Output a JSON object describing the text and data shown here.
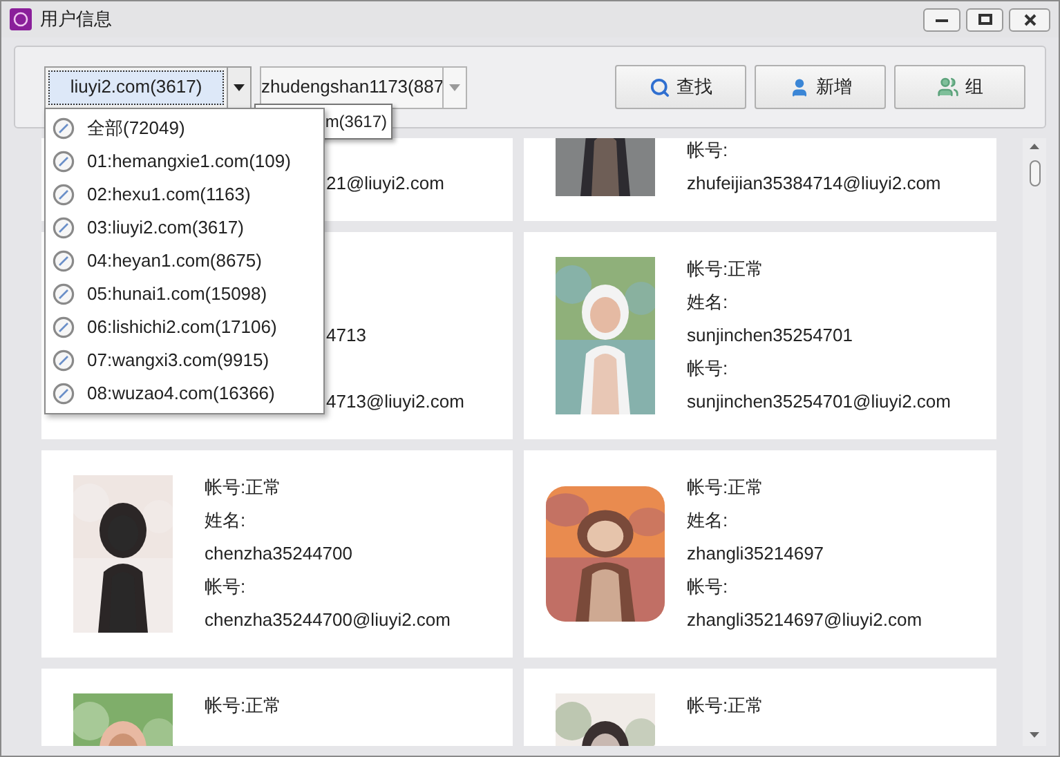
{
  "window": {
    "title": "用户信息"
  },
  "toolbar": {
    "domain_combo": {
      "value": "liuyi2.com(3617)",
      "focused": true
    },
    "user_combo": {
      "value": "zhudengshan1173(887",
      "disabled": true
    },
    "buttons": [
      {
        "kind": "search",
        "label": "查找"
      },
      {
        "kind": "add",
        "label": "新增"
      },
      {
        "kind": "group",
        "label": "组"
      }
    ]
  },
  "tooltip": {
    "text": "m(3617)"
  },
  "domain_dropdown": {
    "items": [
      {
        "label": "全部(72049)"
      },
      {
        "label": "01:hemangxie1.com(109)"
      },
      {
        "label": "02:hexu1.com(1163)"
      },
      {
        "label": "03:liuyi2.com(3617)"
      },
      {
        "label": "04:heyan1.com(8675)"
      },
      {
        "label": "05:hunai1.com(15098)"
      },
      {
        "label": "06:lishichi2.com(17106)"
      },
      {
        "label": "07:wangxi3.com(9915)"
      },
      {
        "label": "08:wuzao4.com(16366)"
      }
    ]
  },
  "cards": [
    {
      "covered": true,
      "email": "21@liuyi2.com"
    },
    {
      "kind": "portrait",
      "covered": false,
      "email_label": "帐号:",
      "email": "zhufeijian35384714@liuyi2.com"
    },
    {
      "covered": true,
      "username": "4713",
      "email": "4713@liuyi2.com"
    },
    {
      "kind": "portrait",
      "covered": false,
      "status": "帐号:正常",
      "name_label": "姓名:",
      "username": "sunjinchen35254701",
      "email_label": "帐号:",
      "email": "sunjinchen35254701@liuyi2.com"
    },
    {
      "kind": "portrait",
      "covered": false,
      "status": "帐号:正常",
      "name_label": "姓名:",
      "username": "chenzha35244700",
      "email_label": "帐号:",
      "email": "chenzha35244700@liuyi2.com"
    },
    {
      "kind": "square",
      "covered": false,
      "status": "帐号:正常",
      "name_label": "姓名:",
      "username": "zhangli35214697",
      "email_label": "帐号:",
      "email": "zhangli35214697@liuyi2.com"
    },
    {
      "kind": "portrait",
      "covered": false,
      "status": "帐号:正常"
    },
    {
      "kind": "portrait",
      "covered": false,
      "status": "帐号:正常"
    }
  ]
}
